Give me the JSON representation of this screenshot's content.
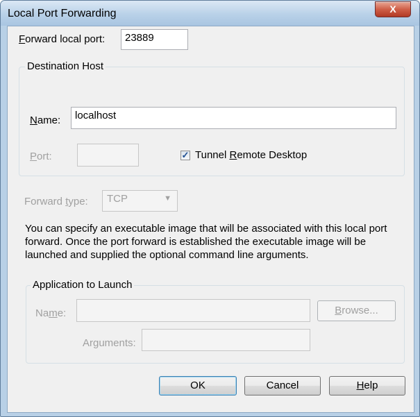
{
  "window": {
    "title": "Local Port Forwarding",
    "close_glyph": "X"
  },
  "forward_local_port": {
    "label_pre": "",
    "label_mnemonic": "F",
    "label_post": "orward local port:",
    "value": "23889"
  },
  "destination_host": {
    "legend": "Destination Host",
    "name": {
      "label_mnemonic": "N",
      "label_post": "ame:",
      "value": "localhost"
    },
    "port": {
      "label_mnemonic": "P",
      "label_post": "ort:",
      "value": ""
    },
    "tunnel_remote_desktop": {
      "label_pre": "Tunnel ",
      "label_mnemonic": "R",
      "label_post": "emote Desktop",
      "checked": true
    }
  },
  "forward_type": {
    "label_pre": "Forward ",
    "label_mnemonic": "t",
    "label_post": "ype:",
    "selected": "TCP"
  },
  "description": "You can specify an executable image that will be associated with this local port forward. Once the port forward is established the executable image will be launched and supplied the optional command line arguments.",
  "application": {
    "legend": "Application to Launch",
    "name": {
      "label_pre": "Na",
      "label_mnemonic": "m",
      "label_post": "e:",
      "value": ""
    },
    "browse": {
      "label_mnemonic": "B",
      "label_post": "rowse..."
    },
    "arguments": {
      "label": "Arguments:",
      "value": ""
    }
  },
  "buttons": {
    "ok": "OK",
    "cancel": "Cancel",
    "help_mnemonic": "H",
    "help_post": "elp"
  },
  "colors": {
    "title_bar": "#b9d1e8",
    "close_button": "#cf5f48",
    "dialog_bg": "#f0f0f0",
    "disabled_text": "#a0a0a0"
  }
}
